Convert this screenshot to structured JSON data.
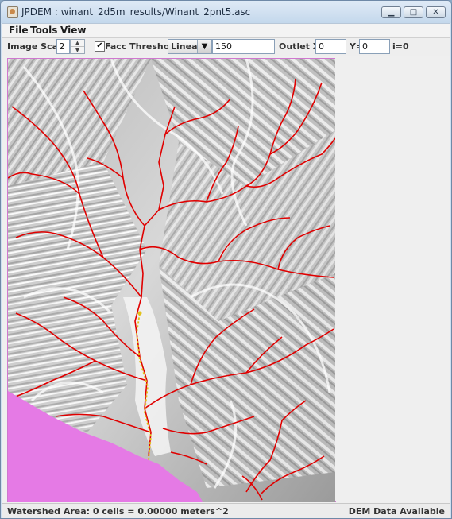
{
  "window": {
    "title": "JPDEM : winant_2d5m_results/Winant_2pnt5.asc"
  },
  "menu": {
    "items": [
      "File",
      "Tools",
      "View"
    ]
  },
  "toolbar": {
    "image_scale_label": "Image Scale",
    "image_scale_value": "2",
    "facc_threshold_label": "Facc Threshold",
    "facc_checked": true,
    "mode_value": "Linear",
    "threshold_value": "150",
    "outlet_x_label": "Outlet X=",
    "outlet_x_value": "0",
    "outlet_y_label": "Y=",
    "outlet_y_value": "0",
    "outlet_i_text": "i=0"
  },
  "status": {
    "watershed_area": "Watershed Area: 0 cells = 0.00000 meters^2",
    "dem_status": "DEM Data Available"
  },
  "colors": {
    "stream": "#e00000",
    "outlet_path": "#e2c21a",
    "no_data": "#e57ae5",
    "terrain_light": "#ffffff",
    "terrain_dark": "#8a8a8a"
  }
}
